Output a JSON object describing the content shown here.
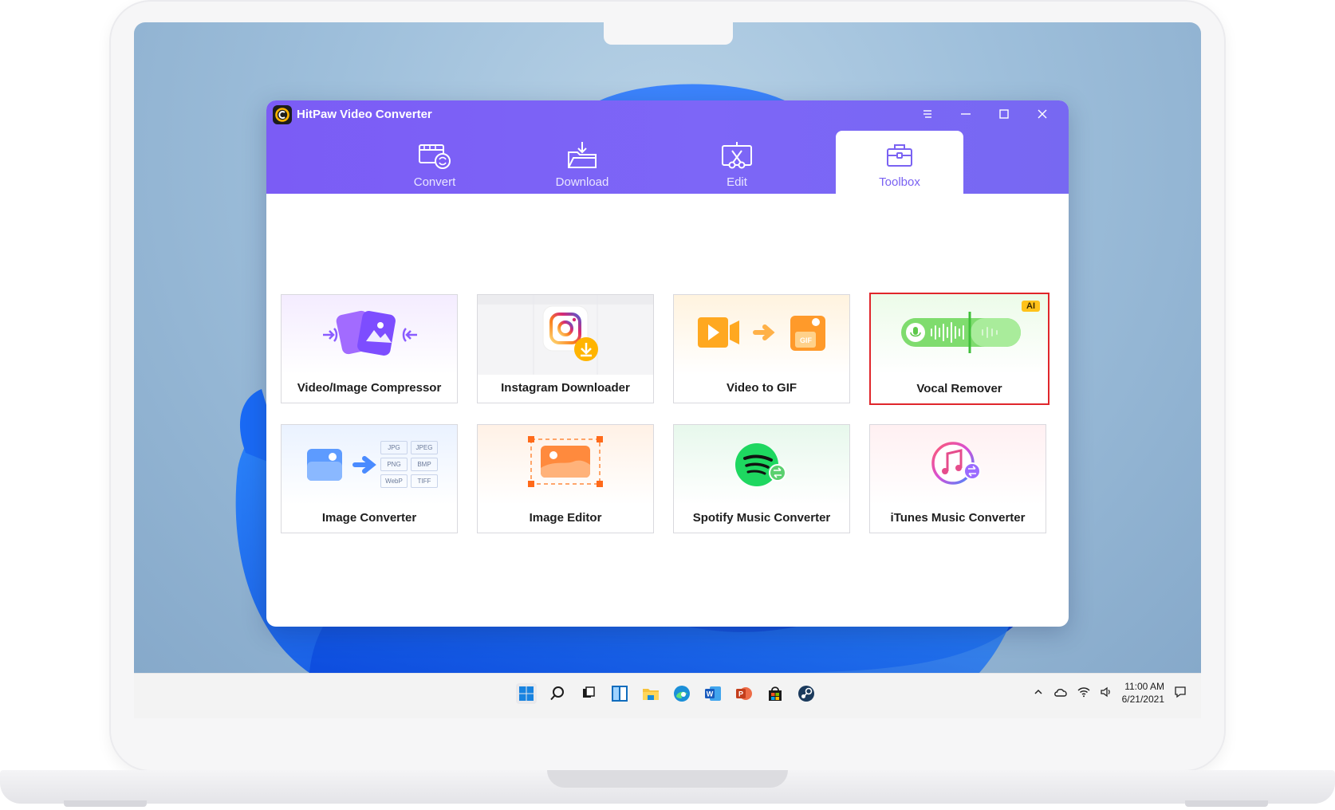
{
  "app": {
    "title": "HitPaw Video Converter",
    "accent": "#7b5cf5",
    "window_controls": [
      "menu-icon",
      "minimize-icon",
      "maximize-icon",
      "close-icon"
    ]
  },
  "tabs": [
    {
      "id": "convert",
      "label": "Convert",
      "icon": "convert-film-icon",
      "active": false
    },
    {
      "id": "download",
      "label": "Download",
      "icon": "download-folder-icon",
      "active": false
    },
    {
      "id": "edit",
      "label": "Edit",
      "icon": "edit-scissors-icon",
      "active": false
    },
    {
      "id": "toolbox",
      "label": "Toolbox",
      "icon": "toolbox-icon",
      "active": true
    }
  ],
  "tools": [
    {
      "id": "compressor",
      "label": "Video/Image Compressor",
      "icon": "compress-icon"
    },
    {
      "id": "instagram",
      "label": "Instagram Downloader",
      "icon": "instagram-icon"
    },
    {
      "id": "gif",
      "label": "Video to GIF",
      "icon": "video-to-gif-icon"
    },
    {
      "id": "vocal",
      "label": "Vocal Remover",
      "icon": "vocal-wave-icon",
      "badge": "AI",
      "selected": true
    },
    {
      "id": "imgconv",
      "label": "Image Converter",
      "icon": "image-convert-icon",
      "formats": [
        "JPG",
        "JPEG",
        "PNG",
        "BMP",
        "WebP",
        "TIFF"
      ]
    },
    {
      "id": "imgedit",
      "label": "Image Editor",
      "icon": "image-edit-icon"
    },
    {
      "id": "spotify",
      "label": "Spotify Music Converter",
      "icon": "spotify-icon"
    },
    {
      "id": "itunes",
      "label": "iTunes Music Converter",
      "icon": "itunes-icon"
    }
  ],
  "taskbar": {
    "apps": [
      "windows-start-icon",
      "search-icon",
      "task-view-icon",
      "widgets-icon",
      "file-explorer-icon",
      "edge-icon",
      "word-icon",
      "powerpoint-icon",
      "store-icon",
      "steam-icon"
    ],
    "tray": [
      "chevron-up-icon",
      "onedrive-icon",
      "wifi-icon",
      "volume-icon"
    ],
    "time": "11:00 AM",
    "date": "6/21/2021"
  }
}
